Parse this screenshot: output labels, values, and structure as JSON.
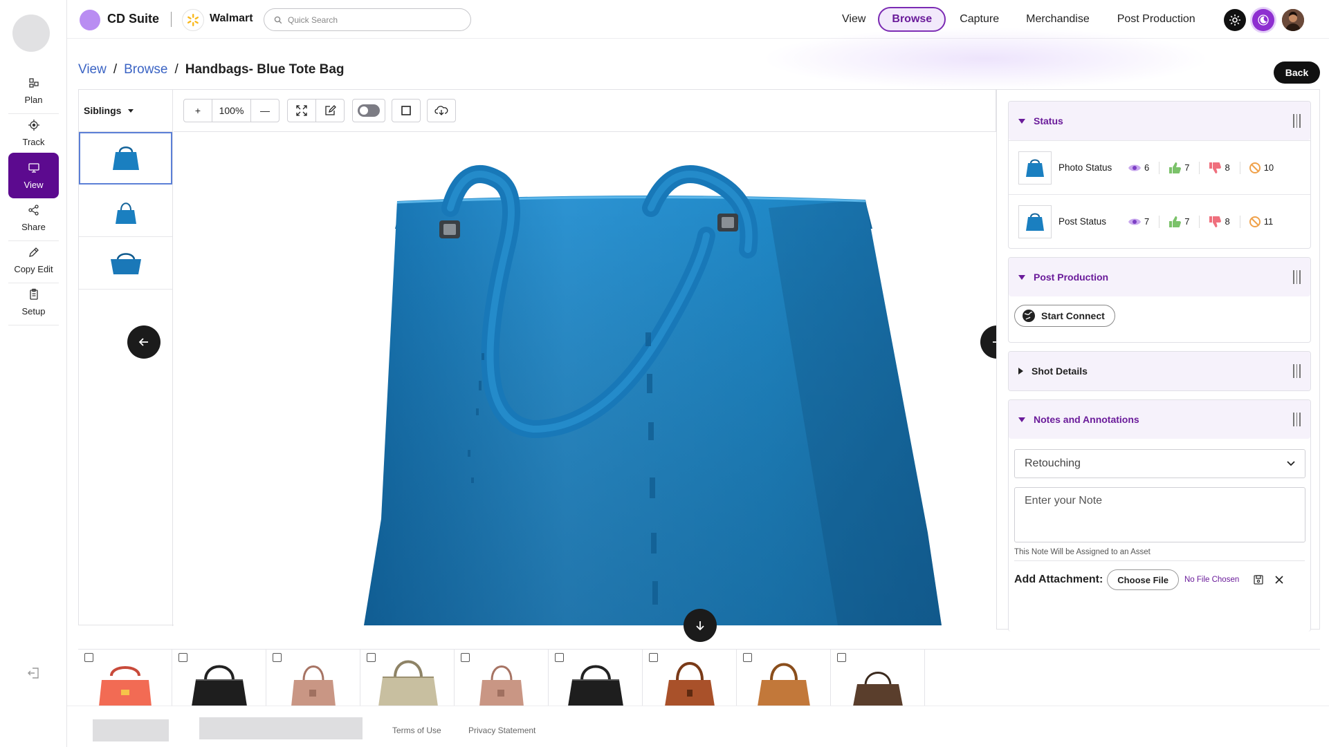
{
  "app": {
    "name": "CD Suite",
    "client": "Walmart"
  },
  "search": {
    "placeholder": "Quick Search"
  },
  "nav": {
    "items": [
      "View",
      "Browse",
      "Capture",
      "Merchandise",
      "Post Production"
    ],
    "active": "Browse"
  },
  "rail": {
    "items": [
      {
        "label": "Plan",
        "icon": "plan-icon"
      },
      {
        "label": "Track",
        "icon": "track-icon"
      },
      {
        "label": "View",
        "icon": "monitor-icon",
        "active": true
      },
      {
        "label": "Share",
        "icon": "share-icon"
      },
      {
        "label": "Copy Edit",
        "icon": "pencil-icon"
      },
      {
        "label": "Setup",
        "icon": "clipboard-icon"
      }
    ]
  },
  "breadcrumb": {
    "view": "View",
    "browse": "Browse",
    "current": "Handbags- Blue Tote Bag",
    "sep": "/"
  },
  "back_label": "Back",
  "siblings": {
    "label": "Siblings"
  },
  "toolbar": {
    "zoom": "100%",
    "plus": "+",
    "minus": "—"
  },
  "status": {
    "title": "Status",
    "rows": [
      {
        "label": "Photo Status",
        "views": "6",
        "likes": "7",
        "dislikes": "8",
        "blocked": "10"
      },
      {
        "label": "Post Status",
        "views": "7",
        "likes": "7",
        "dislikes": "8",
        "blocked": "11"
      }
    ]
  },
  "post_production": {
    "title": "Post Production",
    "button": "Start Connect"
  },
  "shot_details": {
    "title": "Shot Details"
  },
  "notes": {
    "title": "Notes and Annotations",
    "category": "Retouching",
    "placeholder": "Enter your Note",
    "helper": "This Note Will be Assigned to an Asset",
    "attach_label": "Add Attachment:",
    "choose": "Choose File",
    "no_file": "No File Chosen"
  },
  "footer": {
    "terms": "Terms of Use",
    "privacy": "Privacy Statement"
  },
  "colors": {
    "brand": "#5c0a8f",
    "accent": "#6a1b9a",
    "bag_blue": "#1f84c4"
  }
}
